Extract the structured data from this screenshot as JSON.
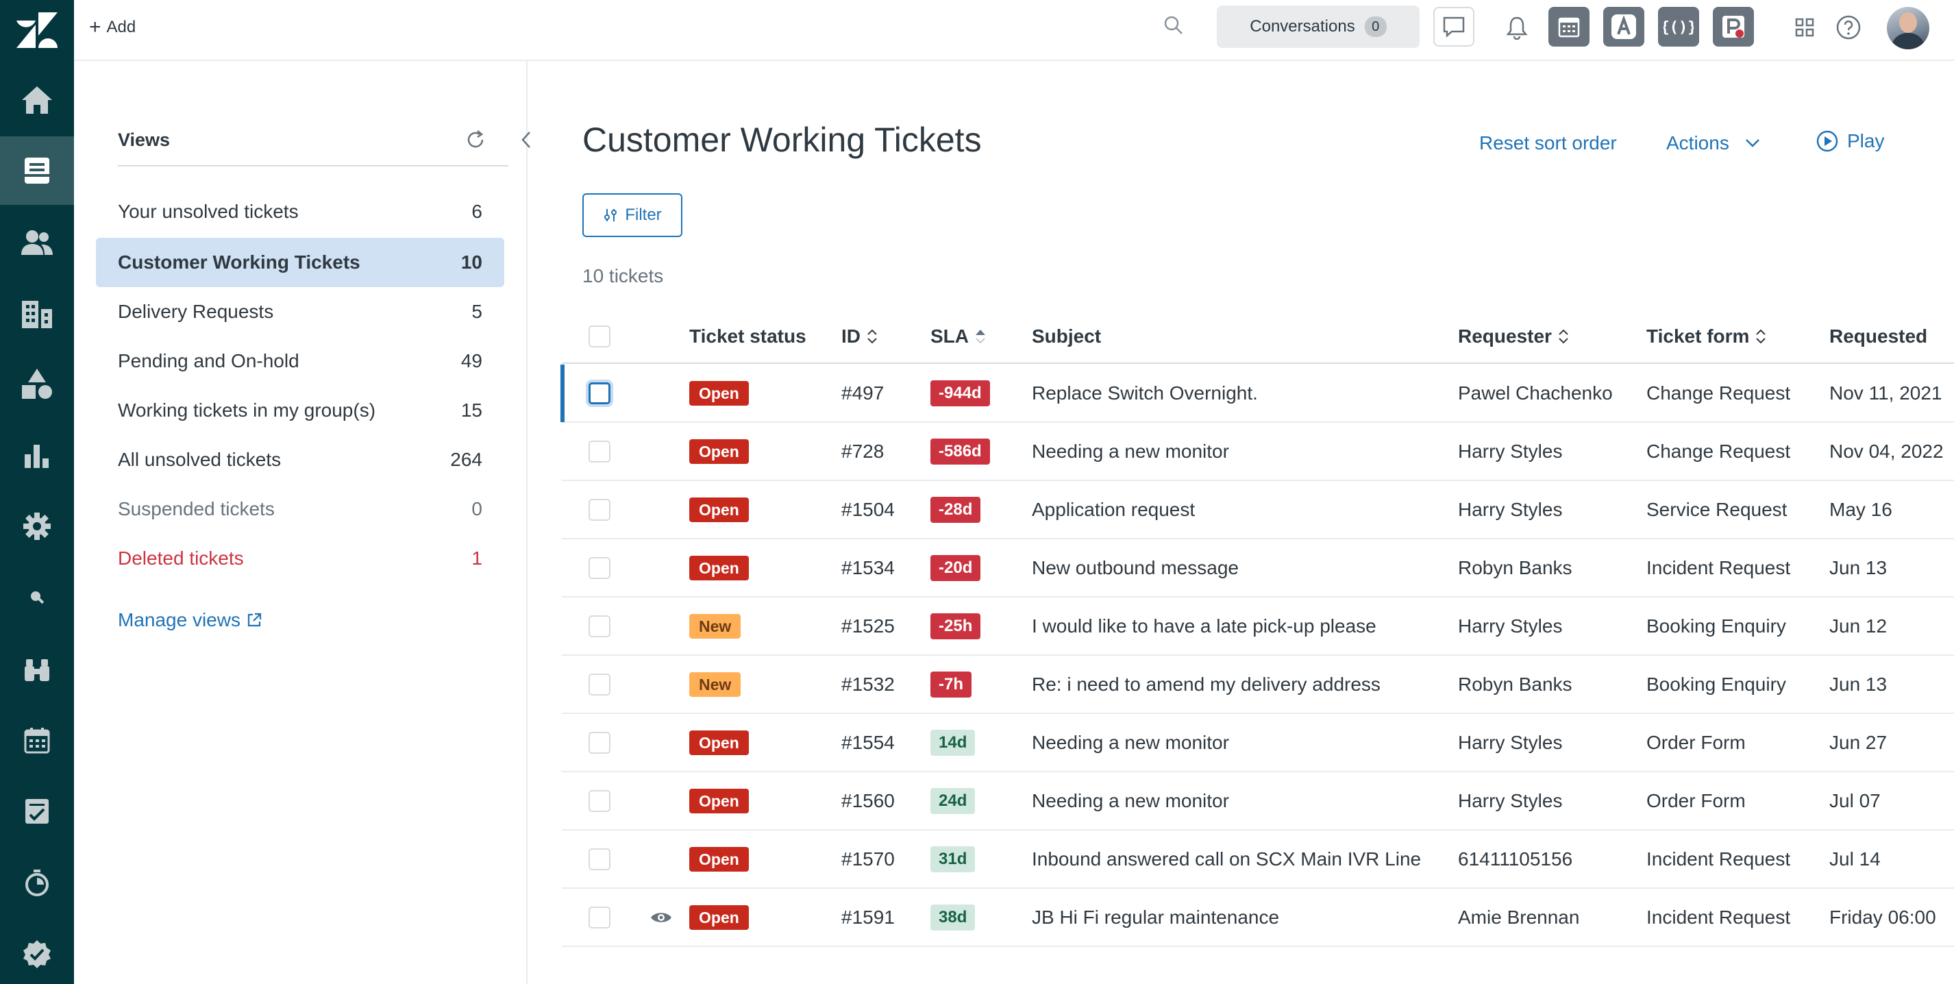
{
  "topbar": {
    "add_label": "Add",
    "conversations_label": "Conversations",
    "conversations_count": "0"
  },
  "views_panel": {
    "title": "Views",
    "items": [
      {
        "label": "Your unsolved tickets",
        "count": "6"
      },
      {
        "label": "Customer Working Tickets",
        "count": "10"
      },
      {
        "label": "Delivery Requests",
        "count": "5"
      },
      {
        "label": "Pending and On-hold",
        "count": "49"
      },
      {
        "label": "Working tickets in my group(s)",
        "count": "15"
      },
      {
        "label": "All unsolved tickets",
        "count": "264"
      },
      {
        "label": "Suspended tickets",
        "count": "0"
      },
      {
        "label": "Deleted tickets",
        "count": "1"
      }
    ],
    "manage_label": "Manage views"
  },
  "main": {
    "title": "Customer Working Tickets",
    "reset_label": "Reset sort order",
    "actions_label": "Actions",
    "play_label": "Play",
    "filter_label": "Filter",
    "ticket_count": "10 tickets"
  },
  "table": {
    "headers": {
      "status": "Ticket status",
      "id": "ID",
      "sla": "SLA",
      "subject": "Subject",
      "requester": "Requester",
      "form": "Ticket form",
      "requested": "Requested"
    },
    "rows": [
      {
        "status": "Open",
        "id": "#497",
        "sla": "-944d",
        "subject": "Replace Switch Overnight.",
        "requester": "Pawel Chachenko",
        "form": "Change Request",
        "requested": "Nov 11, 2021"
      },
      {
        "status": "Open",
        "id": "#728",
        "sla": "-586d",
        "subject": "Needing a new monitor",
        "requester": "Harry Styles",
        "form": "Change Request",
        "requested": "Nov 04, 2022"
      },
      {
        "status": "Open",
        "id": "#1504",
        "sla": "-28d",
        "subject": "Application request",
        "requester": "Harry Styles",
        "form": "Service Request",
        "requested": "May 16"
      },
      {
        "status": "Open",
        "id": "#1534",
        "sla": "-20d",
        "subject": "New outbound message",
        "requester": "Robyn Banks",
        "form": "Incident Request",
        "requested": "Jun 13"
      },
      {
        "status": "New",
        "id": "#1525",
        "sla": "-25h",
        "subject": "I would like to have a late pick-up please",
        "requester": "Harry Styles",
        "form": "Booking Enquiry",
        "requested": "Jun 12"
      },
      {
        "status": "New",
        "id": "#1532",
        "sla": "-7h",
        "subject": "Re: i need to amend my delivery address",
        "requester": "Robyn Banks",
        "form": "Booking Enquiry",
        "requested": "Jun 13"
      },
      {
        "status": "Open",
        "id": "#1554",
        "sla": "14d",
        "subject": "Needing a new monitor",
        "requester": "Harry Styles",
        "form": "Order Form",
        "requested": "Jun 27"
      },
      {
        "status": "Open",
        "id": "#1560",
        "sla": "24d",
        "subject": "Needing a new monitor",
        "requester": "Harry Styles",
        "form": "Order Form",
        "requested": "Jul 07"
      },
      {
        "status": "Open",
        "id": "#1570",
        "sla": "31d",
        "subject": "Inbound answered call on SCX Main IVR Line",
        "requester": "61411105156",
        "form": "Incident Request",
        "requested": "Jul 14"
      },
      {
        "status": "Open",
        "id": "#1591",
        "sla": "38d",
        "subject": "JB Hi Fi regular maintenance",
        "requester": "Amie Brennan",
        "form": "Incident Request",
        "requested": "Friday 06:00"
      }
    ]
  },
  "colors": {
    "rail": "#03363d",
    "accent": "#1f73b7",
    "open": "#c72a1c",
    "new": "#ffb057",
    "sla_breach": "#cc3340",
    "sla_ok": "#d1e8df"
  }
}
